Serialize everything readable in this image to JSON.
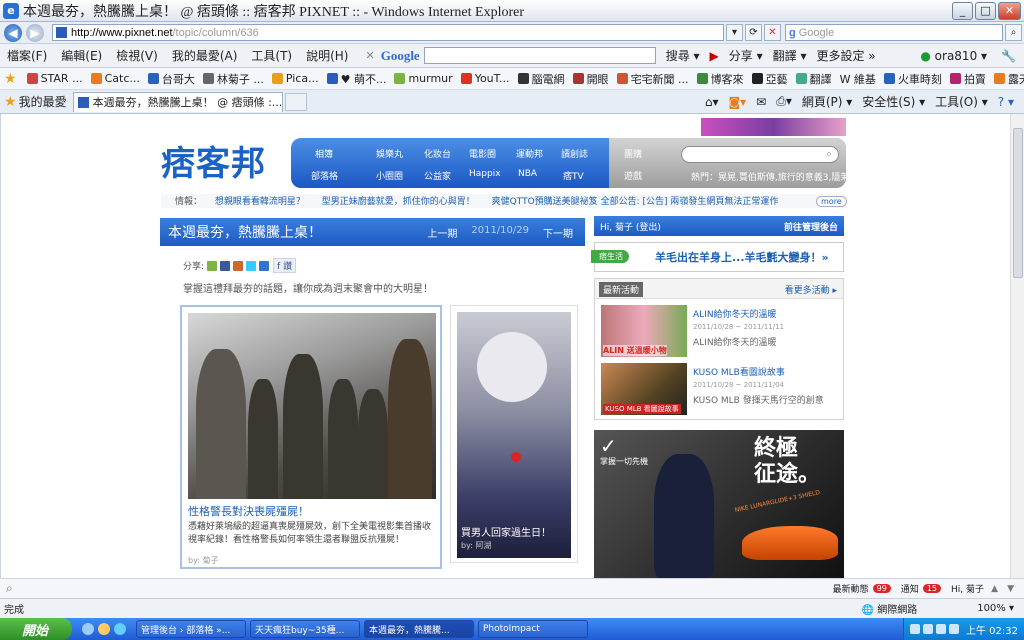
{
  "window": {
    "title": "本週最夯，熱騰騰上桌！ @ 痞頭條 :: 痞客邦 PIXNET :: - Windows Internet Explorer",
    "min": "_",
    "max": "□",
    "close": "✕"
  },
  "address": {
    "url_host": "http://www.pixnet.net",
    "url_path": "/topic/column/636",
    "search_placeholder": "Google"
  },
  "menu": {
    "items": [
      "檔案(F)",
      "編輯(E)",
      "檢視(V)",
      "我的最愛(A)",
      "工具(T)",
      "說明(H)"
    ]
  },
  "google_toolbar": {
    "logo": "Google",
    "buttons": [
      "搜尋 ▾",
      "分享 ▾",
      "翻譯 ▾",
      "更多設定 »"
    ],
    "user": "ora810 ▾"
  },
  "favorites_bar": {
    "items": [
      "STAR ...",
      "Catc...",
      "台哥大",
      "林菊子 ...",
      "Pica...",
      "♥ 萌不...",
      "murmur",
      "YouT...",
      "腦電網",
      "開眼",
      "宅宅新聞 ...",
      "博客來",
      "亞藝",
      "翻譯",
      "W 維基",
      "火車時刻",
      "拍賣",
      "露天"
    ]
  },
  "tabs": {
    "favorites_label": "我的最愛",
    "active_tab": "本週最夯，熱騰騰上桌！ @ 痞頭條 :...",
    "command_items": [
      "網頁(P) ▾",
      "安全性(S) ▾",
      "工具(O) ▾",
      "? ▾"
    ]
  },
  "site": {
    "logo": "痞客邦",
    "nav": [
      "相簿",
      "娛樂丸",
      "化妝台",
      "電影圈",
      "運動邦",
      "讀創誌",
      "部落格",
      "小圈圈",
      "公益家",
      "Happix",
      "NBA",
      "痞TV",
      "團購",
      "遊戲"
    ],
    "hot": "熱門：晃晃,賈伯斯傳,旅行的意義3,隱茉",
    "info_label": "情報：",
    "info_items": [
      "想親眼看看韓流明星？",
      "型男正妹廚藝就愛，抓住你的心與胃！",
      "爽健QTTO預購送美腿祕笈",
      "全部公告: [公告] 兩嶺發生網頁無法正常運作"
    ],
    "more": "more"
  },
  "article": {
    "title": "本週最夯，熱騰騰上桌！",
    "prev": "上一期",
    "date": "2011/10/29",
    "next": "下一期",
    "share_label": "分享:",
    "share_extra": "f 讚",
    "intro": "掌握這禮拜最夯的話題，讓你成為週末聚會中的大明星！",
    "card1": {
      "caption": "性格警長對決喪屍殭屍！",
      "desc": "憑藉好萊塢級的超逼真喪屍殭屍效，創下全美電視影集首播收視率紀錄！看性格警長如何率領生還者聯盟反抗殭屍！",
      "by": "by: 菊子"
    },
    "card2": {
      "caption": "買男人回家過生日！",
      "by": "by: 阿湖"
    }
  },
  "sidebar": {
    "login_greet": "Hi, 菊子 (登出)",
    "login_link": "前往管理後台",
    "life_tag": "痞生活",
    "life_text": "羊毛出在羊身上...羊毛氈大變身！»",
    "events_label": "最新活動",
    "events_more": "看更多活動 ▸",
    "events": [
      {
        "title": "ALIN給你冬天的溫暖",
        "date": "2011/10/28 ~ 2011/11/11",
        "sub": "ALIN給你冬天的溫暖",
        "thumb_text": "ALIN 送溫暖小物"
      },
      {
        "title": "KUSO MLB看圖說故事",
        "date": "2011/10/28 ~ 2011/11/04",
        "sub": "KUSO MLB 發揮天馬行空的創意",
        "thumb_text": "KUSO MLB 看圖說故事"
      }
    ],
    "ad": {
      "slogan": "掌握一切先機",
      "big1": "終極",
      "big2": "征途。",
      "small": "NIKE LUNARGLIDE+3 SHIELD"
    }
  },
  "notif": {
    "news_label": "最新動態",
    "news_count": "99",
    "notice_label": "通知",
    "notice_count": "15",
    "user": "Hi, 菊子"
  },
  "status": {
    "left": "完成",
    "zone": "網際網路",
    "zoom": "100%"
  },
  "taskbar": {
    "start": "開始",
    "tasks": [
      "管理後台 › 部落格 »...",
      "天天瘋狂buy~35種...",
      "本週最夯，熱騰騰...",
      "PhotoImpact"
    ],
    "clock": "上午 02:32"
  }
}
